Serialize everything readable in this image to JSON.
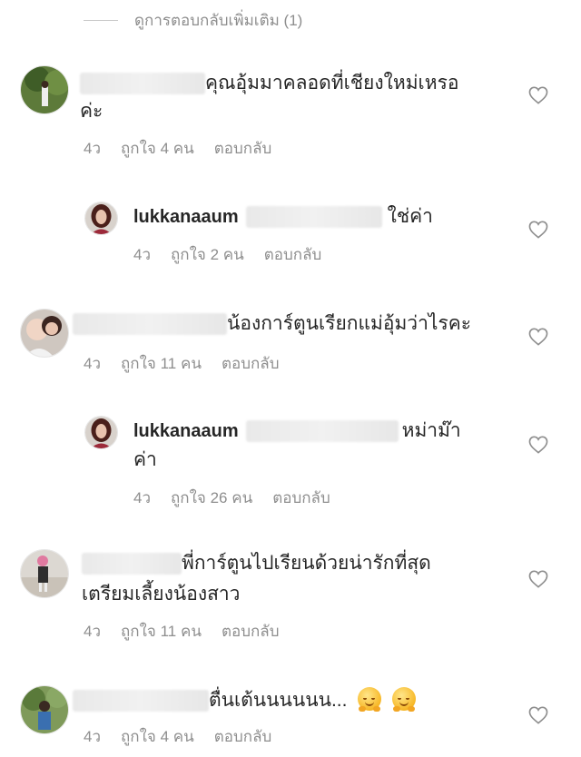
{
  "more_replies": {
    "label": "ดูการตอบกลับเพิ่มเติม (1)"
  },
  "comments": [
    {
      "line1": "คุณอุ้มมาคลอดที่เชียงใหม่เหรอ",
      "line2": "ค่ะ",
      "time": "4ว",
      "likes": "ถูกใจ 4 คน",
      "reply": "ตอบกลับ"
    },
    {
      "username": "lukkanaaum",
      "text": "ใช่ค่า",
      "time": "4ว",
      "likes": "ถูกใจ 2 คน",
      "reply": "ตอบกลับ"
    },
    {
      "line1": "น้องการ์ตูนเรียกแม่อุ้มว่าไรคะ",
      "time": "4ว",
      "likes": "ถูกใจ 11 คน",
      "reply": "ตอบกลับ"
    },
    {
      "username": "lukkanaaum",
      "text": "หม่าม๊า",
      "line2": "ค่า",
      "time": "4ว",
      "likes": "ถูกใจ 26 คน",
      "reply": "ตอบกลับ"
    },
    {
      "line1": "พี่การ์ตูนไปเรียนด้วยน่ารักที่สุด",
      "line2": "เตรียมเลี้ยงน้องสาว",
      "time": "4ว",
      "likes": "ถูกใจ 11 คน",
      "reply": "ตอบกลับ"
    },
    {
      "line1": "ตื่นเต้นนนนนน...",
      "time": "4ว",
      "likes": "ถูกใจ 4 คน",
      "reply": "ตอบกลับ"
    }
  ],
  "icons": {
    "like": "heart-outline-icon",
    "emoji": "smiling-face-with-open-hands"
  },
  "colors": {
    "text": "#262626",
    "meta": "#8e8e8e",
    "background": "#ffffff"
  }
}
